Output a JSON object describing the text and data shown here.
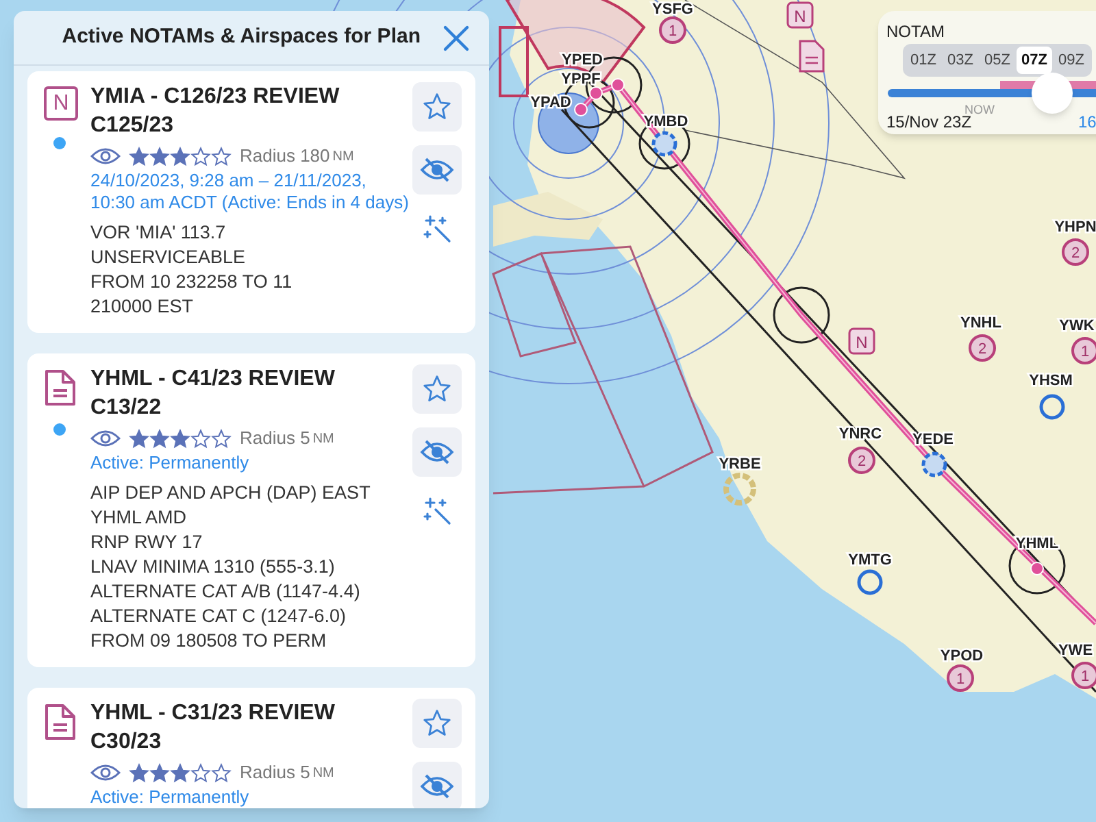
{
  "panel": {
    "title": "Active NOTAMs & Airspaces for Plan"
  },
  "notams": [
    {
      "kind": "notam",
      "icon_letter": "N",
      "title": "YMIA - C126/23 REVIEW C125/23",
      "unread": true,
      "stars": 3,
      "radius": "Radius 180",
      "radius_unit": "NM",
      "validity": "24/10/2023, 9:28 am – 21/11/2023, 10:30 am ACDT (Active: Ends in 4 days)",
      "body": [
        "VOR 'MIA' 113.7",
        "UNSERVICEABLE",
        "FROM 10 232258 TO 11",
        "210000 EST"
      ],
      "assist": true
    },
    {
      "kind": "document",
      "title": "YHML - C41/23 REVIEW C13/22",
      "unread": true,
      "stars": 3,
      "radius": "Radius 5",
      "radius_unit": "NM",
      "validity": "Active: Permanently",
      "body": [
        "AIP DEP AND APCH (DAP) EAST",
        "YHML AMD",
        "RNP RWY 17",
        "LNAV MINIMA 1310 (555-3.1)",
        "ALTERNATE CAT A/B (1147-4.4)",
        "ALTERNATE CAT C (1247-6.0)",
        "FROM 09 180508 TO PERM"
      ],
      "assist": true
    },
    {
      "kind": "document",
      "title": "YHML - C31/23 REVIEW C30/23",
      "unread": false,
      "stars": 3,
      "radius": "Radius 5",
      "radius_unit": "NM",
      "validity": "Active: Permanently"
    }
  ],
  "timeline": {
    "title": "NOTAM",
    "hours": [
      {
        "label": "01Z",
        "selected": false
      },
      {
        "label": "03Z",
        "selected": false
      },
      {
        "label": "05Z",
        "selected": false
      },
      {
        "label": "07Z",
        "selected": true
      },
      {
        "label": "09Z",
        "selected": false
      }
    ],
    "now_label": "NOW",
    "level": 0.75,
    "start": "15/Nov 23Z",
    "end": "16"
  },
  "map": {
    "airports": [
      {
        "code": "YSFG",
        "kind": "numbered",
        "badge": "1"
      },
      {
        "code": "YPED",
        "kind": "waypoint"
      },
      {
        "code": "YPPF",
        "kind": "waypoint"
      },
      {
        "code": "YPAD",
        "kind": "waypoint"
      },
      {
        "code": "YMBD",
        "kind": "dashed"
      },
      {
        "code": "YHPN",
        "kind": "numbered",
        "badge": "2"
      },
      {
        "code": "YNHL",
        "kind": "numbered",
        "badge": "2"
      },
      {
        "code": "YWK",
        "kind": "numbered",
        "badge": "1"
      },
      {
        "code": "YHSM",
        "kind": "towered"
      },
      {
        "code": "YNRC",
        "kind": "numbered",
        "badge": "2"
      },
      {
        "code": "YEDE",
        "kind": "dashed"
      },
      {
        "code": "YRBE",
        "kind": "gold"
      },
      {
        "code": "YHML",
        "kind": "waypoint"
      },
      {
        "code": "YMTG",
        "kind": "towered"
      },
      {
        "code": "YPOD",
        "kind": "numbered",
        "badge": "1"
      },
      {
        "code": "YWE",
        "kind": "numbered",
        "badge": "1"
      }
    ],
    "markers": [
      {
        "kind": "notam",
        "letter": "N"
      },
      {
        "kind": "document"
      },
      {
        "kind": "notam",
        "letter": "N"
      }
    ]
  }
}
